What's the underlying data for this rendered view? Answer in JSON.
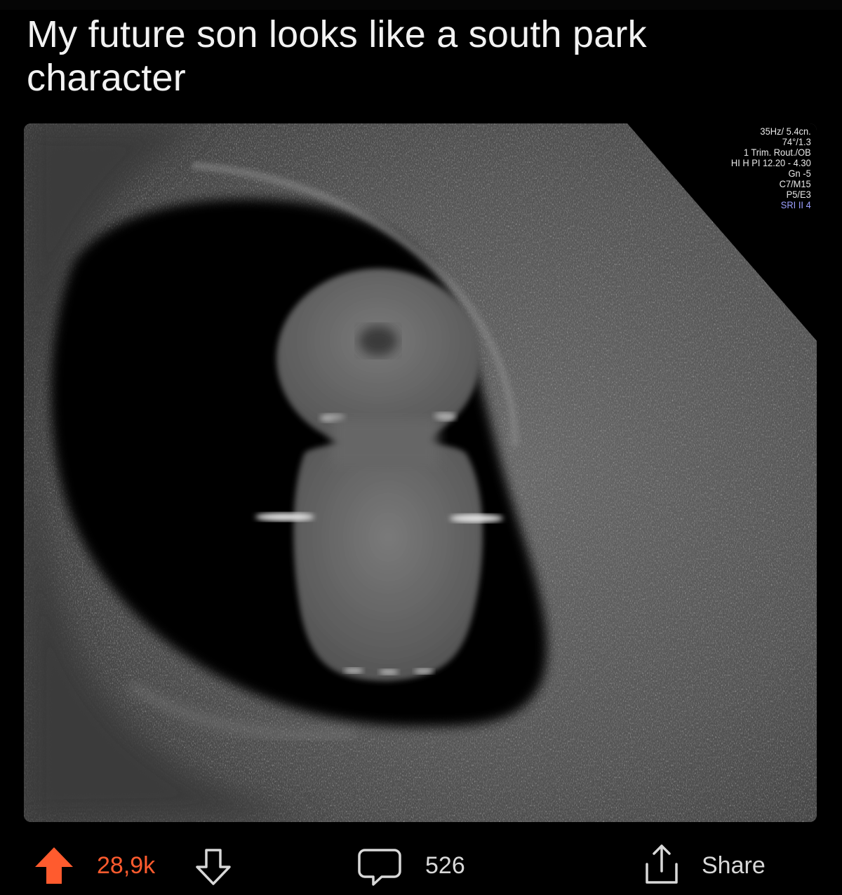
{
  "post": {
    "title": "My future son looks like a south park character"
  },
  "image": {
    "scan_info": [
      "35Hz/ 5.4cn.",
      "74°/1.3",
      "1 Trim. Rout./OB",
      "HI H PI 12.20 - 4.30",
      "Gn -5",
      "C7/M15",
      "P5/E3",
      "SRI II 4"
    ]
  },
  "actions": {
    "score": "28,9k",
    "comment_count": "526",
    "share_label": "Share",
    "upvote_icon": "arrow-up-filled-icon",
    "downvote_icon": "arrow-down-outline-icon",
    "comment_icon": "speech-bubble-icon",
    "share_icon": "share-upload-icon"
  },
  "colors": {
    "background": "#000000",
    "upvote_accent": "#ff5b2e",
    "text_primary": "#f2f2f2",
    "text_secondary": "#d8d8d8"
  }
}
